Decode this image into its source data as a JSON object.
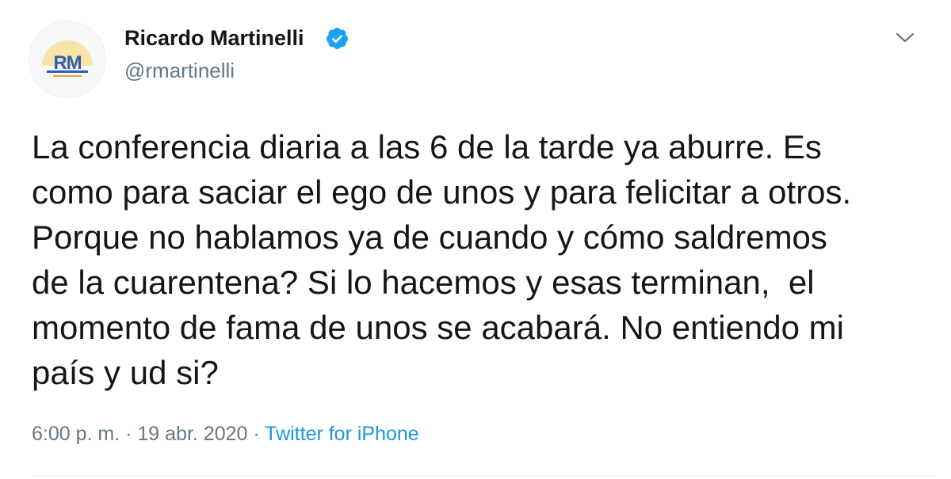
{
  "author": {
    "name": "Ricardo Martinelli",
    "handle": "@rmartinelli",
    "avatar_text": "RM",
    "verified_icon": "verified-badge-icon"
  },
  "tweet": {
    "text": "La conferencia diaria a las 6 de la tarde ya aburre. Es\ncomo para saciar el ego de unos y para felicitar a otros.\nPorque no hablamos ya de cuando y cómo saldremos\nde la cuarentena? Si lo hacemos y esas terminan,  el\nmomento de fama de unos se acabará. No entiendo mi\npaís y ud si?"
  },
  "meta": {
    "time": "6:00 p. m.",
    "separator": " · ",
    "date": "19 abr. 2020",
    "source": "Twitter for iPhone"
  },
  "colors": {
    "verified_blue": "#1da1f2",
    "link_blue": "#1b95e0",
    "secondary_text": "#657786",
    "primary_text": "#14171a"
  }
}
